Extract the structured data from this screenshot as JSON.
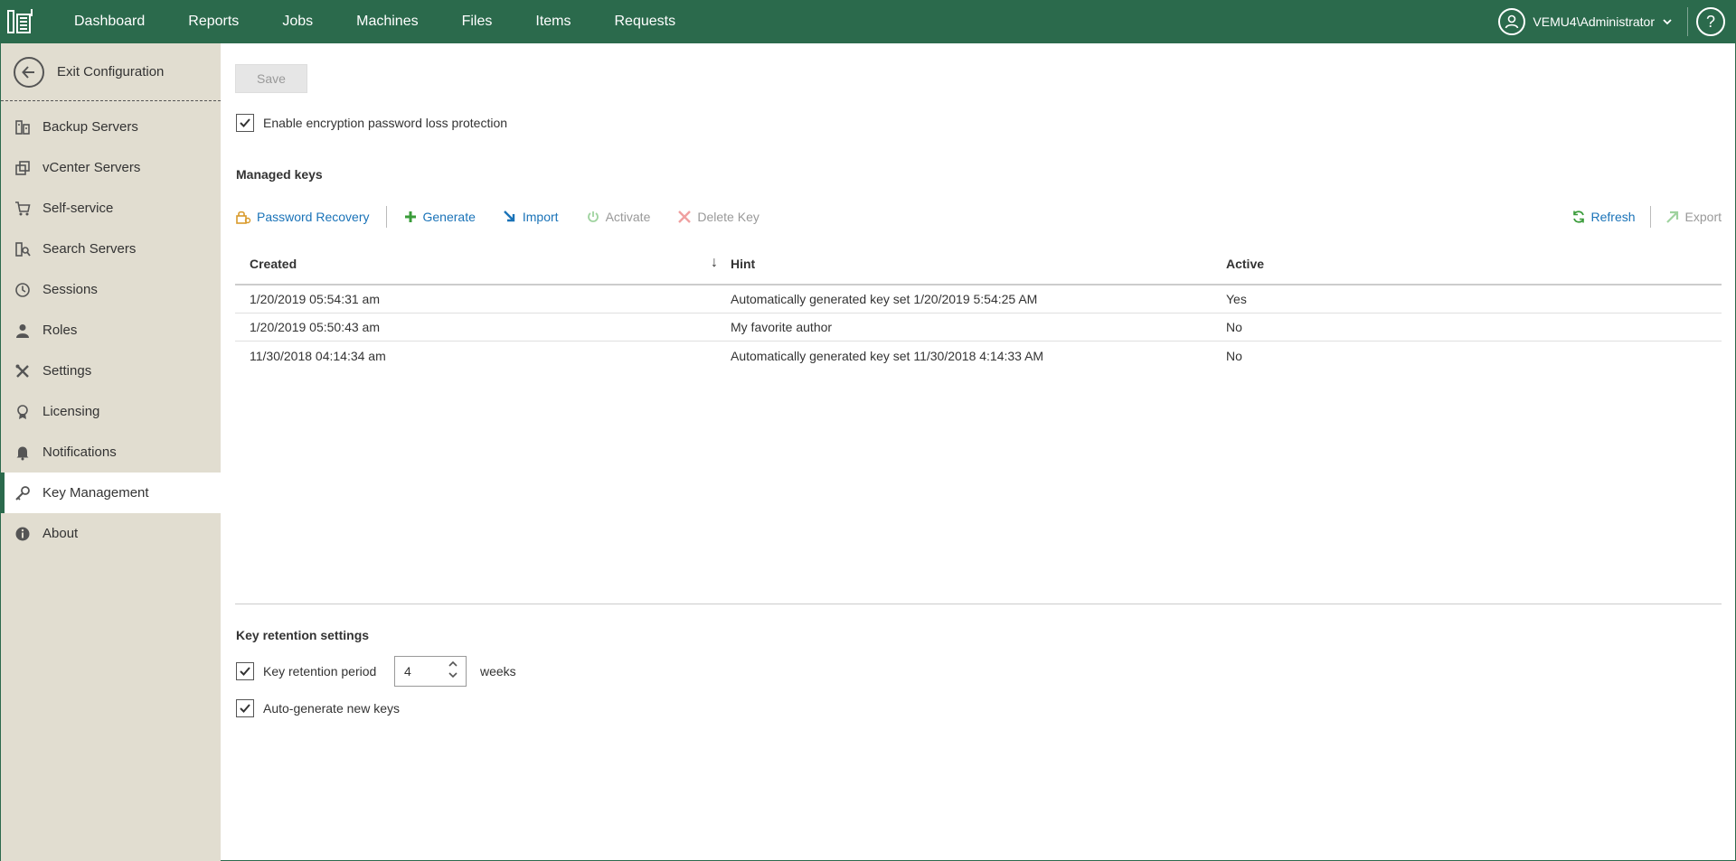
{
  "topbar": {
    "nav": [
      "Dashboard",
      "Reports",
      "Jobs",
      "Machines",
      "Files",
      "Items",
      "Requests"
    ],
    "user": "VEMU4\\Administrator",
    "help": "?"
  },
  "sidebar": {
    "exit_label": "Exit Configuration",
    "items": [
      {
        "label": "Backup Servers",
        "icon": "backup-servers-icon"
      },
      {
        "label": "vCenter Servers",
        "icon": "vcenter-servers-icon"
      },
      {
        "label": "Self-service",
        "icon": "cart-icon"
      },
      {
        "label": "Search Servers",
        "icon": "search-servers-icon"
      },
      {
        "label": "Sessions",
        "icon": "clock-icon"
      },
      {
        "label": "Roles",
        "icon": "person-icon"
      },
      {
        "label": "Settings",
        "icon": "tools-icon"
      },
      {
        "label": "Licensing",
        "icon": "license-icon"
      },
      {
        "label": "Notifications",
        "icon": "bell-icon"
      },
      {
        "label": "Key Management",
        "icon": "key-icon",
        "active": true
      },
      {
        "label": "About",
        "icon": "info-icon"
      }
    ]
  },
  "main": {
    "save_label": "Save",
    "enable_protection_label": "Enable encryption password loss protection",
    "managed_keys_title": "Managed keys",
    "toolbar": {
      "password_recovery": "Password Recovery",
      "generate": "Generate",
      "import": "Import",
      "activate": "Activate",
      "delete_key": "Delete Key",
      "refresh": "Refresh",
      "export": "Export"
    },
    "table": {
      "headers": [
        "Created",
        "Hint",
        "Active"
      ],
      "rows": [
        [
          "1/20/2019 05:54:31 am",
          "Automatically generated key set 1/20/2019 5:54:25 AM",
          "Yes"
        ],
        [
          "1/20/2019 05:50:43 am",
          "My favorite author",
          "No"
        ],
        [
          "11/30/2018 04:14:34 am",
          "Automatically generated key set 11/30/2018 4:14:33 AM",
          "No"
        ]
      ]
    },
    "retention": {
      "title": "Key retention settings",
      "period_label": "Key retention period",
      "period_value": "4",
      "period_unit": "weeks",
      "autogen_label": "Auto-generate new keys"
    }
  },
  "colors": {
    "brand": "#2b6a4c",
    "sidebar_bg": "#e1ddd0",
    "link": "#1a73b8"
  }
}
